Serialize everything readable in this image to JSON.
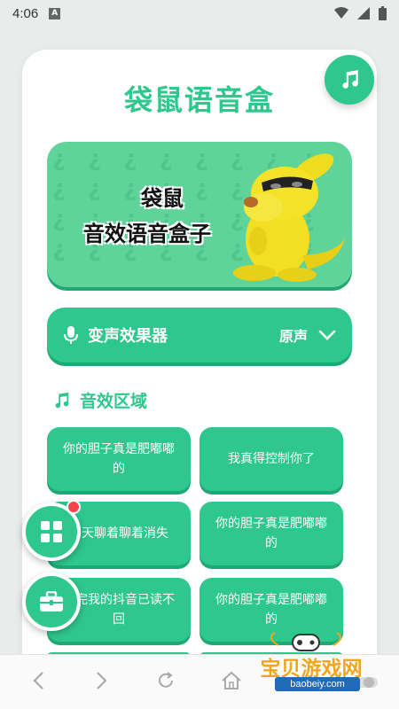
{
  "status_bar": {
    "time": "4:06",
    "badge": "A"
  },
  "app": {
    "title": "袋鼠语音盒"
  },
  "banner": {
    "line1": "袋鼠",
    "line2": "音效语音盒子",
    "pattern_glyph": "¿"
  },
  "voice_effect": {
    "label": "变声效果器",
    "value": "原声"
  },
  "section": {
    "title": "音效区域"
  },
  "sounds": [
    "你的胆子真是肥嘟嘟的",
    "我真得控制你了",
    "聊天聊着聊着消失",
    "你的胆子真是肥嘟嘟的",
    "看完我的抖音已读不回",
    "你的胆子真是肥嘟嘟的"
  ],
  "watermark": {
    "text": "宝贝游戏网",
    "url": "baobeiy.com"
  },
  "colors": {
    "accent": "#2ec78d",
    "accent_dark": "#1fa873",
    "banner_bg": "#5fd39a",
    "badge_red": "#f5454a"
  },
  "icons": {
    "fab": "music-note-icon",
    "voice": "microphone-icon",
    "section": "music-note-icon",
    "float_1": "grid-icon",
    "float_2": "toolbox-icon"
  }
}
